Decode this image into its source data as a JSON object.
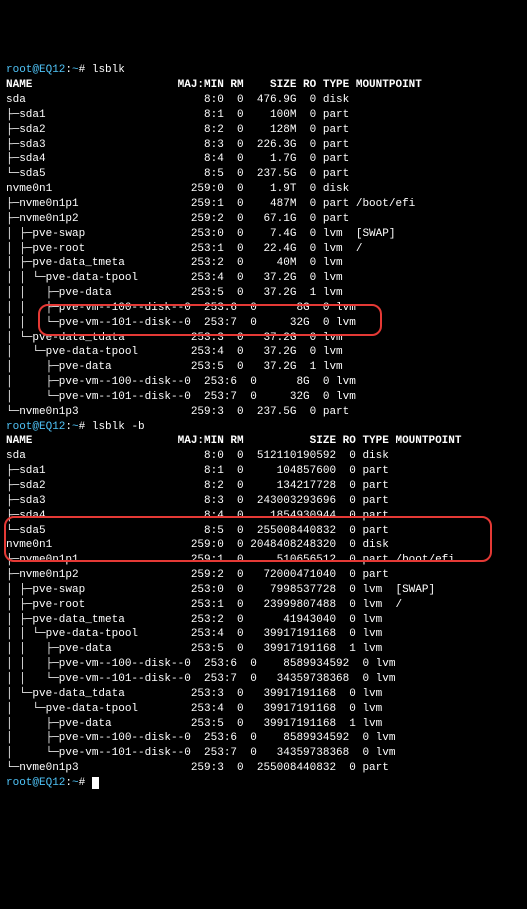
{
  "prompt1": {
    "userhost": "root@EQ12",
    "cwd": "~",
    "cmd": "lsblk"
  },
  "prompt2": {
    "userhost": "root@EQ12",
    "cwd": "~",
    "cmd": "lsblk -b"
  },
  "prompt3": {
    "userhost": "root@EQ12",
    "cwd": "~",
    "cmd": ""
  },
  "header1": "NAME                      MAJ:MIN RM    SIZE RO TYPE MOUNTPOINT",
  "header2": "NAME                      MAJ:MIN RM          SIZE RO TYPE MOUNTPOINT",
  "table1": [
    {
      "tree": "sda                       ",
      "mm": "  8:0",
      "rm": "0",
      "size": " 476.9G",
      "ro": "0",
      "type": "disk",
      "mnt": ""
    },
    {
      "tree": "├─sda1                    ",
      "mm": "  8:1",
      "rm": "0",
      "size": "   100M",
      "ro": "0",
      "type": "part",
      "mnt": ""
    },
    {
      "tree": "├─sda2                    ",
      "mm": "  8:2",
      "rm": "0",
      "size": "   128M",
      "ro": "0",
      "type": "part",
      "mnt": ""
    },
    {
      "tree": "├─sda3                    ",
      "mm": "  8:3",
      "rm": "0",
      "size": " 226.3G",
      "ro": "0",
      "type": "part",
      "mnt": ""
    },
    {
      "tree": "├─sda4                    ",
      "mm": "  8:4",
      "rm": "0",
      "size": "   1.7G",
      "ro": "0",
      "type": "part",
      "mnt": ""
    },
    {
      "tree": "└─sda5                    ",
      "mm": "  8:5",
      "rm": "0",
      "size": " 237.5G",
      "ro": "0",
      "type": "part",
      "mnt": ""
    },
    {
      "tree": "nvme0n1                   ",
      "mm": "259:0",
      "rm": "0",
      "size": "   1.9T",
      "ro": "0",
      "type": "disk",
      "mnt": ""
    },
    {
      "tree": "├─nvme0n1p1               ",
      "mm": "259:1",
      "rm": "0",
      "size": "   487M",
      "ro": "0",
      "type": "part",
      "mnt": "/boot/efi"
    },
    {
      "tree": "├─nvme0n1p2               ",
      "mm": "259:2",
      "rm": "0",
      "size": "  67.1G",
      "ro": "0",
      "type": "part",
      "mnt": ""
    },
    {
      "tree": "│ ├─pve-swap              ",
      "mm": "253:0",
      "rm": "0",
      "size": "   7.4G",
      "ro": "0",
      "type": "lvm ",
      "mnt": "[SWAP]"
    },
    {
      "tree": "│ ├─pve-root              ",
      "mm": "253:1",
      "rm": "0",
      "size": "  22.4G",
      "ro": "0",
      "type": "lvm ",
      "mnt": "/"
    },
    {
      "tree": "│ ├─pve-data_tmeta        ",
      "mm": "253:2",
      "rm": "0",
      "size": "    40M",
      "ro": "0",
      "type": "lvm ",
      "mnt": ""
    },
    {
      "tree": "│ │ └─pve-data-tpool      ",
      "mm": "253:4",
      "rm": "0",
      "size": "  37.2G",
      "ro": "0",
      "type": "lvm ",
      "mnt": ""
    },
    {
      "tree": "│ │   ├─pve-data          ",
      "mm": "253:5",
      "rm": "0",
      "size": "  37.2G",
      "ro": "1",
      "type": "lvm ",
      "mnt": ""
    },
    {
      "tree": "│ │   ├─pve-vm--100--disk--0",
      "mm": "253:6",
      "rm": "0",
      "size": "     8G",
      "ro": "0",
      "type": "lvm ",
      "mnt": ""
    },
    {
      "tree": "│ │   └─pve-vm--101--disk--0",
      "mm": "253:7",
      "rm": "0",
      "size": "    32G",
      "ro": "0",
      "type": "lvm ",
      "mnt": ""
    },
    {
      "tree": "│ └─pve-data_tdata        ",
      "mm": "253:3",
      "rm": "0",
      "size": "  37.2G",
      "ro": "0",
      "type": "lvm ",
      "mnt": ""
    },
    {
      "tree": "│   └─pve-data-tpool      ",
      "mm": "253:4",
      "rm": "0",
      "size": "  37.2G",
      "ro": "0",
      "type": "lvm ",
      "mnt": ""
    },
    {
      "tree": "│     ├─pve-data          ",
      "mm": "253:5",
      "rm": "0",
      "size": "  37.2G",
      "ro": "1",
      "type": "lvm ",
      "mnt": ""
    },
    {
      "tree": "│     ├─pve-vm--100--disk--0",
      "mm": "253:6",
      "rm": "0",
      "size": "     8G",
      "ro": "0",
      "type": "lvm ",
      "mnt": ""
    },
    {
      "tree": "│     └─pve-vm--101--disk--0",
      "mm": "253:7",
      "rm": "0",
      "size": "    32G",
      "ro": "0",
      "type": "lvm ",
      "mnt": ""
    },
    {
      "tree": "└─nvme0n1p3               ",
      "mm": "259:3",
      "rm": "0",
      "size": " 237.5G",
      "ro": "0",
      "type": "part",
      "mnt": ""
    }
  ],
  "table2": [
    {
      "tree": "sda                       ",
      "mm": "  8:0",
      "rm": "0",
      "size": " 512110190592",
      "ro": "0",
      "type": "disk",
      "mnt": ""
    },
    {
      "tree": "├─sda1                    ",
      "mm": "  8:1",
      "rm": "0",
      "size": "    104857600",
      "ro": "0",
      "type": "part",
      "mnt": ""
    },
    {
      "tree": "├─sda2                    ",
      "mm": "  8:2",
      "rm": "0",
      "size": "    134217728",
      "ro": "0",
      "type": "part",
      "mnt": ""
    },
    {
      "tree": "├─sda3                    ",
      "mm": "  8:3",
      "rm": "0",
      "size": " 243003293696",
      "ro": "0",
      "type": "part",
      "mnt": ""
    },
    {
      "tree": "├─sda4                    ",
      "mm": "  8:4",
      "rm": "0",
      "size": "   1854930944",
      "ro": "0",
      "type": "part",
      "mnt": ""
    },
    {
      "tree": "└─sda5                    ",
      "mm": "  8:5",
      "rm": "0",
      "size": " 255008440832",
      "ro": "0",
      "type": "part",
      "mnt": ""
    },
    {
      "tree": "nvme0n1                   ",
      "mm": "259:0",
      "rm": "0",
      "size": "2048408248320",
      "ro": "0",
      "type": "disk",
      "mnt": ""
    },
    {
      "tree": "├─nvme0n1p1               ",
      "mm": "259:1",
      "rm": "0",
      "size": "    510656512",
      "ro": "0",
      "type": "part",
      "mnt": "/boot/efi"
    },
    {
      "tree": "├─nvme0n1p2               ",
      "mm": "259:2",
      "rm": "0",
      "size": "  72000471040",
      "ro": "0",
      "type": "part",
      "mnt": ""
    },
    {
      "tree": "│ ├─pve-swap              ",
      "mm": "253:0",
      "rm": "0",
      "size": "   7998537728",
      "ro": "0",
      "type": "lvm ",
      "mnt": "[SWAP]"
    },
    {
      "tree": "│ ├─pve-root              ",
      "mm": "253:1",
      "rm": "0",
      "size": "  23999807488",
      "ro": "0",
      "type": "lvm ",
      "mnt": "/"
    },
    {
      "tree": "│ ├─pve-data_tmeta        ",
      "mm": "253:2",
      "rm": "0",
      "size": "     41943040",
      "ro": "0",
      "type": "lvm ",
      "mnt": ""
    },
    {
      "tree": "│ │ └─pve-data-tpool      ",
      "mm": "253:4",
      "rm": "0",
      "size": "  39917191168",
      "ro": "0",
      "type": "lvm ",
      "mnt": ""
    },
    {
      "tree": "│ │   ├─pve-data          ",
      "mm": "253:5",
      "rm": "0",
      "size": "  39917191168",
      "ro": "1",
      "type": "lvm ",
      "mnt": ""
    },
    {
      "tree": "│ │   ├─pve-vm--100--disk--0",
      "mm": "253:6",
      "rm": "0",
      "size": "   8589934592",
      "ro": "0",
      "type": "lvm ",
      "mnt": ""
    },
    {
      "tree": "│ │   └─pve-vm--101--disk--0",
      "mm": "253:7",
      "rm": "0",
      "size": "  34359738368",
      "ro": "0",
      "type": "lvm ",
      "mnt": ""
    },
    {
      "tree": "│ └─pve-data_tdata        ",
      "mm": "253:3",
      "rm": "0",
      "size": "  39917191168",
      "ro": "0",
      "type": "lvm ",
      "mnt": ""
    },
    {
      "tree": "│   └─pve-data-tpool      ",
      "mm": "253:4",
      "rm": "0",
      "size": "  39917191168",
      "ro": "0",
      "type": "lvm ",
      "mnt": ""
    },
    {
      "tree": "│     ├─pve-data          ",
      "mm": "253:5",
      "rm": "0",
      "size": "  39917191168",
      "ro": "1",
      "type": "lvm ",
      "mnt": ""
    },
    {
      "tree": "│     ├─pve-vm--100--disk--0",
      "mm": "253:6",
      "rm": "0",
      "size": "   8589934592",
      "ro": "0",
      "type": "lvm ",
      "mnt": ""
    },
    {
      "tree": "│     └─pve-vm--101--disk--0",
      "mm": "253:7",
      "rm": "0",
      "size": "  34359738368",
      "ro": "0",
      "type": "lvm ",
      "mnt": ""
    },
    {
      "tree": "└─nvme0n1p3               ",
      "mm": "259:3",
      "rm": "0",
      "size": " 255008440832",
      "ro": "0",
      "type": "part",
      "mnt": ""
    }
  ]
}
